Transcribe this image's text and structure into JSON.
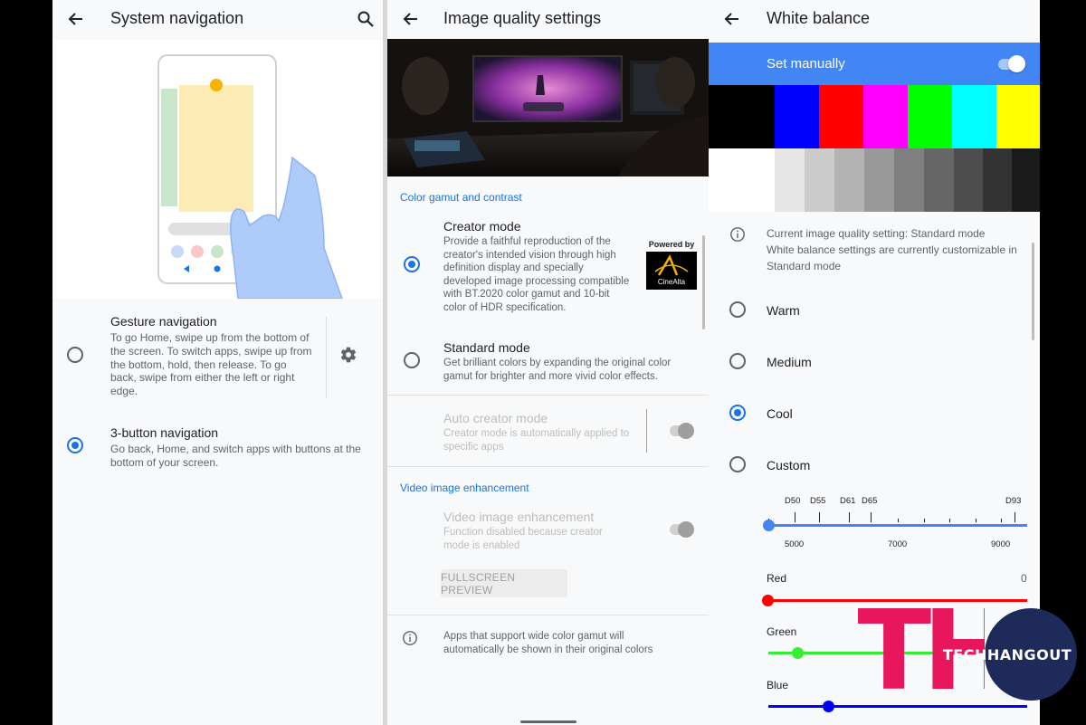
{
  "panel1": {
    "title": "System navigation",
    "gesture": {
      "title": "Gesture navigation",
      "desc": "To go Home, swipe up from the bottom of the screen. To switch apps, swipe up from the bottom, hold, then release. To go back, swipe from either the left or right edge."
    },
    "three_button": {
      "title": "3-button navigation",
      "desc": "Go back, Home, and switch apps with buttons at the bottom of your screen."
    },
    "selected": "3-button navigation"
  },
  "panel2": {
    "title": "Image quality settings",
    "section1": "Color gamut and contrast",
    "creator": {
      "title": "Creator mode",
      "desc": "Provide a faithful reproduction of the creator's intended vision through high definition display and specially developed image processing compatible with BT.2020 color gamut and 10-bit color of HDR specification.",
      "powered_by": "Powered by",
      "logo_text": "CineAlta"
    },
    "standard": {
      "title": "Standard mode",
      "desc": "Get brilliant colors by expanding the original color gamut for brighter and more vivid color effects."
    },
    "auto_creator": {
      "title": "Auto creator mode",
      "desc": "Creator mode is automatically applied to specific apps"
    },
    "section2": "Video image enhancement",
    "vie": {
      "title": "Video image enhancement",
      "desc": "Function disabled because creator mode is enabled"
    },
    "preview_button": "FULLSCREEN PREVIEW",
    "info": "Apps that support wide color gamut will automatically be shown in their original colors",
    "selected": "Creator mode"
  },
  "panel3": {
    "title": "White balance",
    "set_manually": "Set manually",
    "set_manually_on": true,
    "color_bars": [
      "#000000",
      "#0000ff",
      "#ff0000",
      "#ff00ff",
      "#00ff00",
      "#00ffff",
      "#ffff00"
    ],
    "gray_bars": [
      "#ffffff",
      "#e6e6e6",
      "#cccccc",
      "#b3b3b3",
      "#999999",
      "#808080",
      "#666666",
      "#4d4d4d",
      "#333333",
      "#1a1a1a"
    ],
    "info_line1": "Current image quality setting: Standard mode",
    "info_line2": "White balance settings are currently customizable in Standard mode",
    "options": [
      "Warm",
      "Medium",
      "Cool",
      "Custom"
    ],
    "selected": "Cool",
    "temp_labels": [
      "D50",
      "D55",
      "D61",
      "D65",
      "D93"
    ],
    "temp_scale": [
      "5000",
      "7000",
      "9000"
    ],
    "red_label": "Red",
    "red_value": "0",
    "green_label": "Green",
    "blue_label": "Blue",
    "red_color": "#ff0000",
    "green_color": "#33ee33",
    "blue_color": "#0000ff",
    "accent": "#1a73e8"
  },
  "watermark": {
    "letters": "TH",
    "text": "TECHHANGOUT",
    "pink": "#e8175d",
    "navy": "#1e2a5a"
  }
}
